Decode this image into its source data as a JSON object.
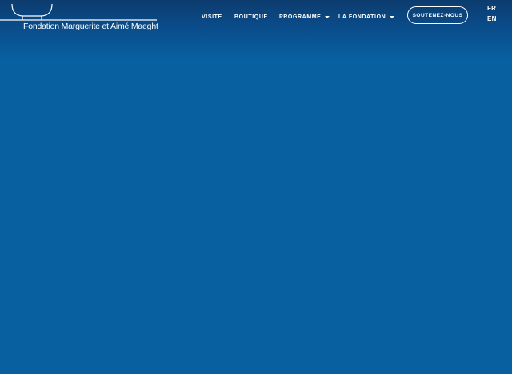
{
  "brand": {
    "name": "Fondation Marguerite et Aimé Maeght"
  },
  "nav": {
    "items": [
      {
        "label": "VISITE",
        "has_dropdown": false
      },
      {
        "label": "BOUTIQUE",
        "has_dropdown": false
      },
      {
        "label": "PROGRAMME",
        "has_dropdown": true
      },
      {
        "label": "LA FONDATION",
        "has_dropdown": true
      }
    ],
    "cta_label": "SOUTENEZ-NOUS"
  },
  "languages": [
    "FR",
    "EN"
  ],
  "colors": {
    "hero_background": "#0860a0",
    "header_top": "#0c3c6e",
    "text": "#ffffff"
  }
}
